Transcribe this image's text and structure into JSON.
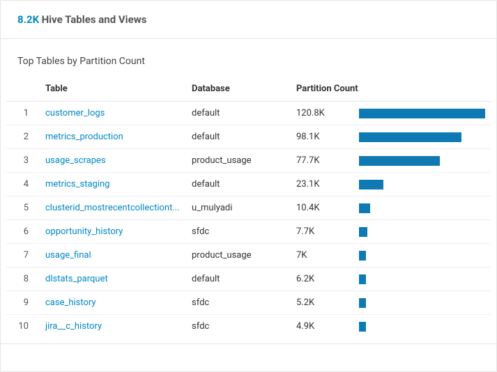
{
  "header": {
    "count_label": "8.2K",
    "title": "Hive Tables and Views"
  },
  "section": {
    "title": "Top Tables by Partition Count"
  },
  "columns": {
    "rank": "",
    "table": "Table",
    "database": "Database",
    "count": "Partition Count"
  },
  "max_count": 120800,
  "rows": [
    {
      "rank": "1",
      "table": "customer_logs",
      "database": "default",
      "count_label": "120.8K",
      "count": 120800
    },
    {
      "rank": "2",
      "table": "metrics_production",
      "database": "default",
      "count_label": "98.1K",
      "count": 98100
    },
    {
      "rank": "3",
      "table": "usage_scrapes",
      "database": "product_usage",
      "count_label": "77.7K",
      "count": 77700
    },
    {
      "rank": "4",
      "table": "metrics_staging",
      "database": "default",
      "count_label": "23.1K",
      "count": 23100
    },
    {
      "rank": "5",
      "table": "clusterid_mostrecentcollectiont...",
      "database": "u_mulyadi",
      "count_label": "10.4K",
      "count": 10400
    },
    {
      "rank": "6",
      "table": "opportunity_history",
      "database": "sfdc",
      "count_label": "7.7K",
      "count": 7700
    },
    {
      "rank": "7",
      "table": "usage_final",
      "database": "product_usage",
      "count_label": "7K",
      "count": 7000
    },
    {
      "rank": "8",
      "table": "dlstats_parquet",
      "database": "default",
      "count_label": "6.2K",
      "count": 6200
    },
    {
      "rank": "9",
      "table": "case_history",
      "database": "sfdc",
      "count_label": "5.2K",
      "count": 5200
    },
    {
      "rank": "10",
      "table": "jira__c_history",
      "database": "sfdc",
      "count_label": "4.9K",
      "count": 4900
    }
  ],
  "chart_data": {
    "type": "bar",
    "title": "Top Tables by Partition Count",
    "xlabel": "Partition Count",
    "ylabel": "Table",
    "categories": [
      "customer_logs",
      "metrics_production",
      "usage_scrapes",
      "metrics_staging",
      "clusterid_mostrecentcollectiont...",
      "opportunity_history",
      "usage_final",
      "dlstats_parquet",
      "case_history",
      "jira__c_history"
    ],
    "values": [
      120800,
      98100,
      77700,
      23100,
      10400,
      7700,
      7000,
      6200,
      5200,
      4900
    ]
  }
}
